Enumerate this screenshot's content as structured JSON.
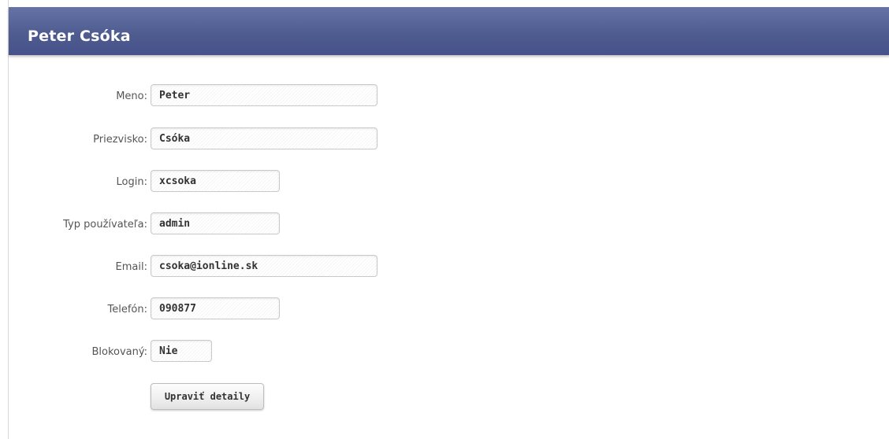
{
  "header": {
    "title": "Peter Csóka"
  },
  "form": {
    "fields": [
      {
        "label": "Meno:",
        "value": "Peter"
      },
      {
        "label": "Priezvisko:",
        "value": "Csóka"
      },
      {
        "label": "Login:",
        "value": "xcsoka"
      },
      {
        "label": "Typ používateľa:",
        "value": "admin"
      },
      {
        "label": "Email:",
        "value": "csoka@ionline.sk"
      },
      {
        "label": "Telefón:",
        "value": "090877"
      },
      {
        "label": "Blokovaný:",
        "value": "Nie"
      }
    ],
    "submit_label": "Upraviť detaily"
  },
  "colors": {
    "header_bg": "#4f5c8f",
    "header_text": "#ffffff"
  }
}
